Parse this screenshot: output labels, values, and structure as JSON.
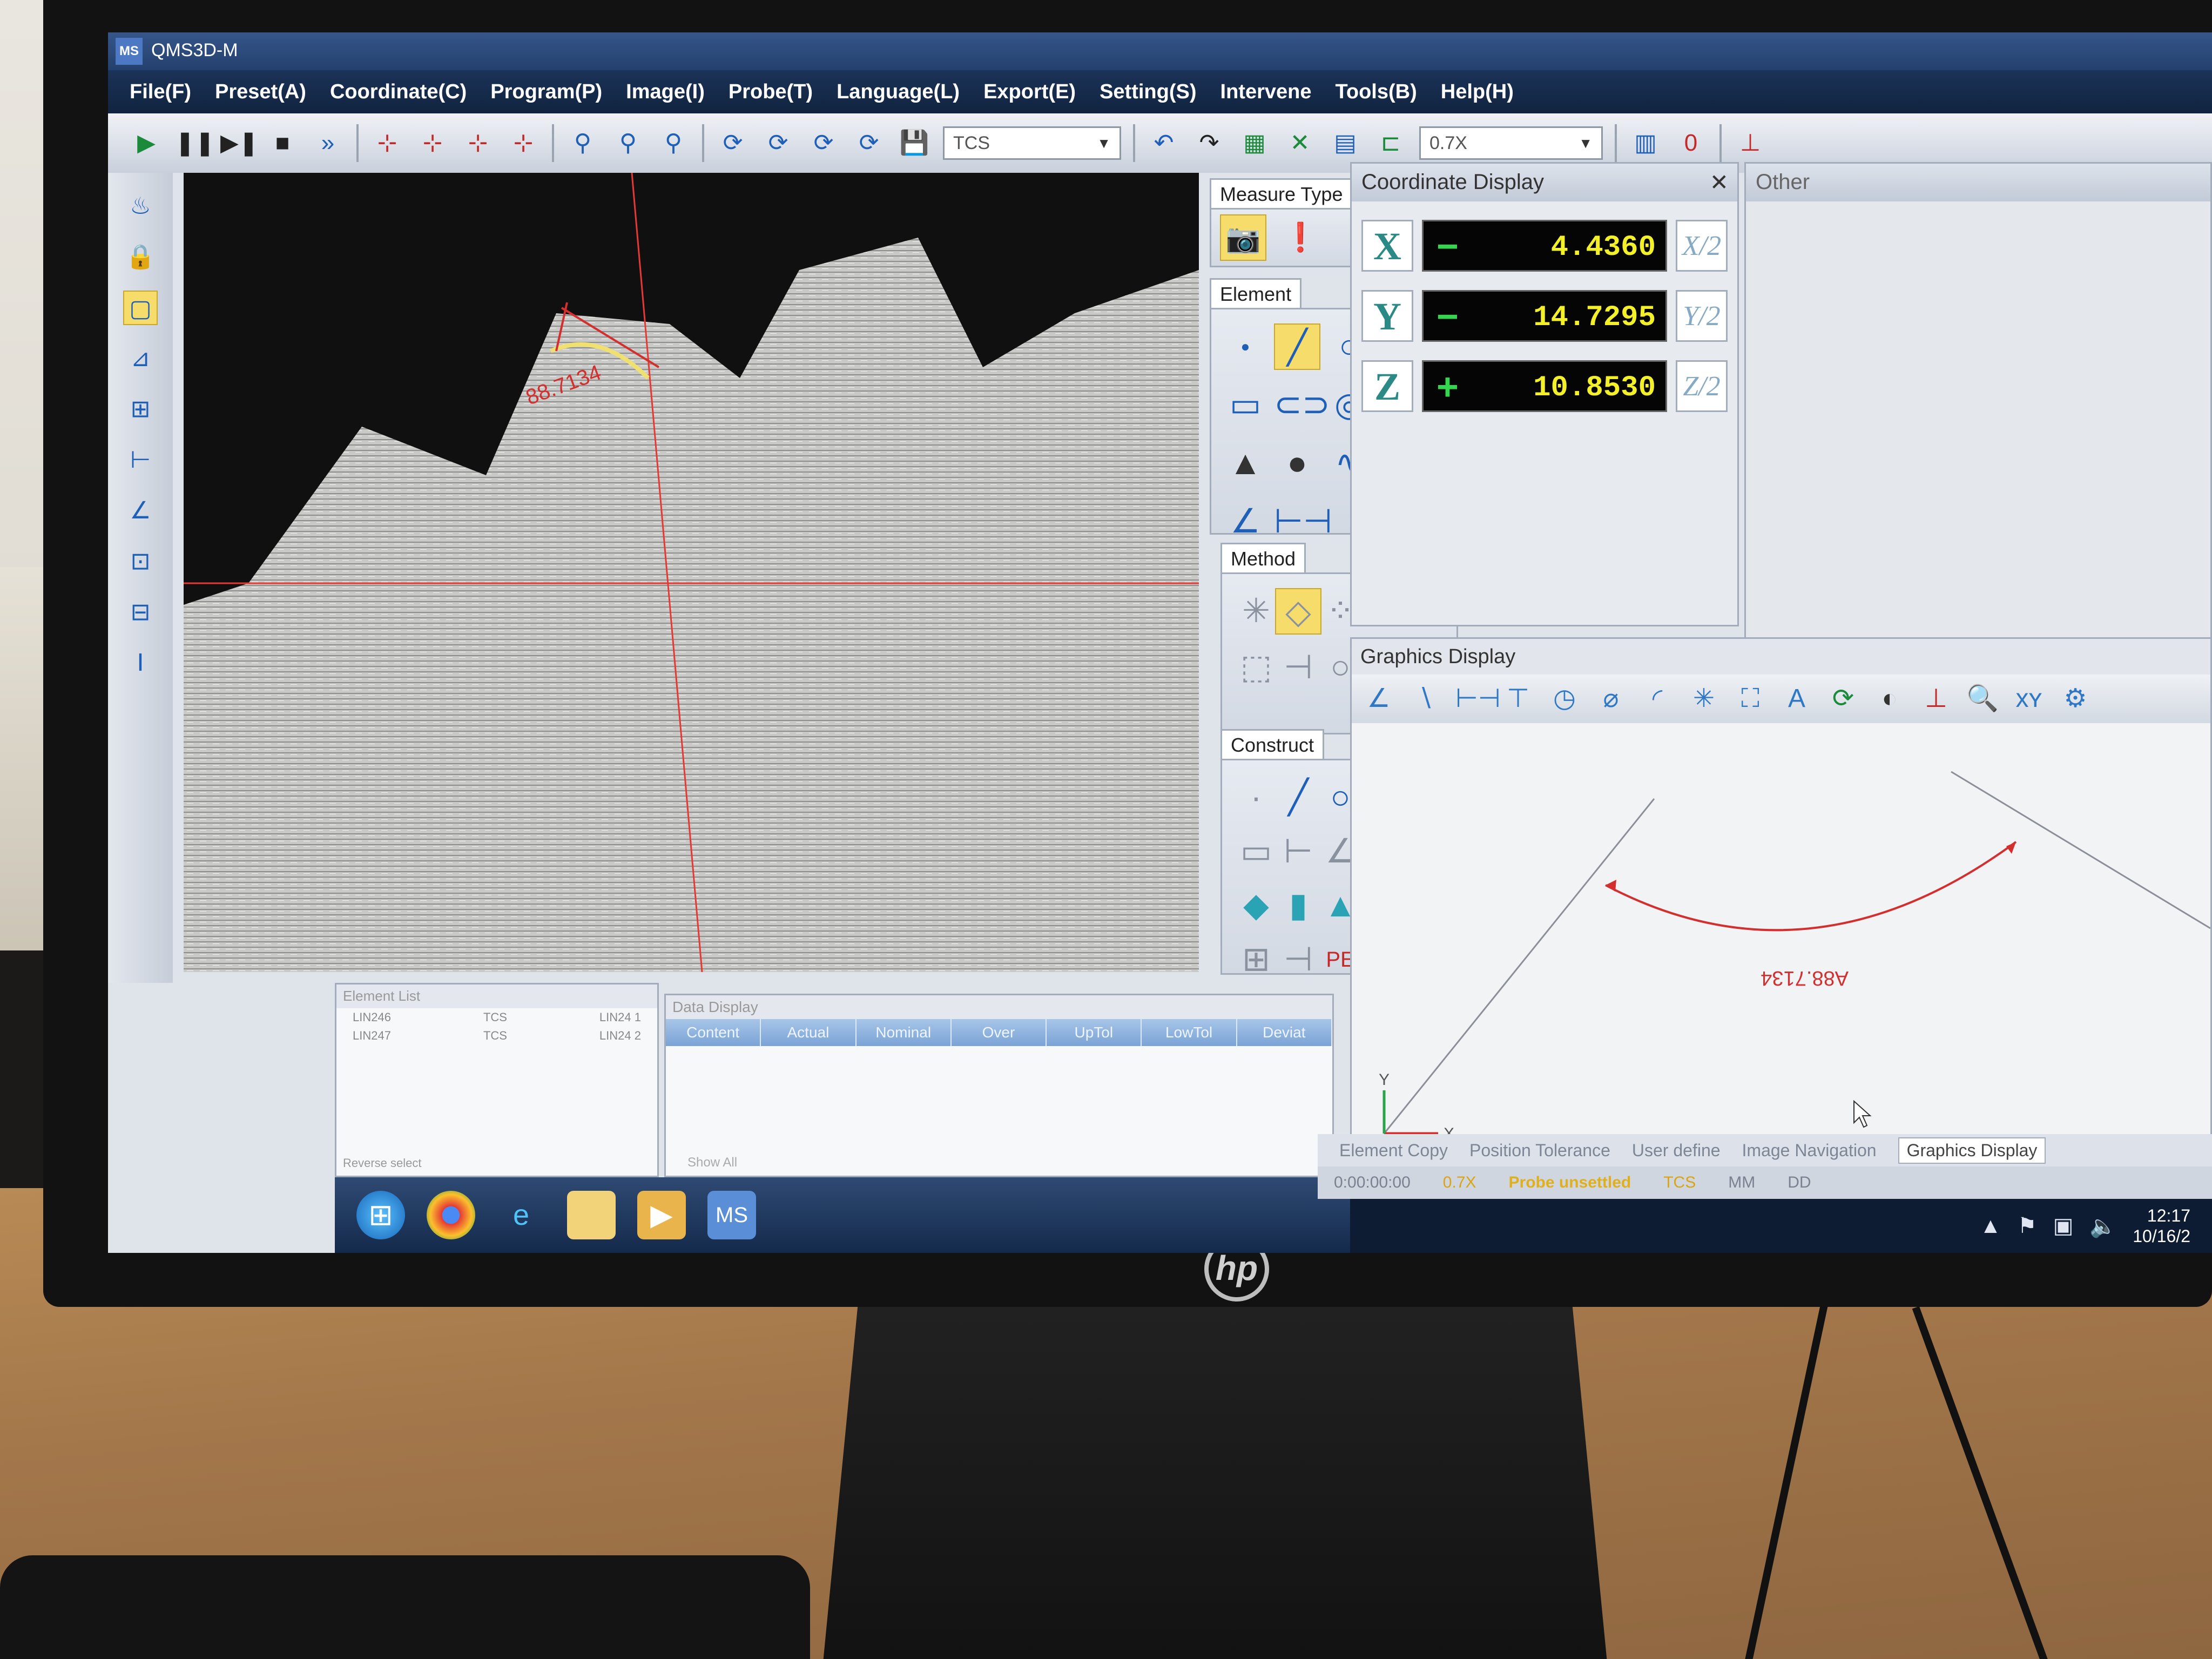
{
  "app": {
    "title": "QMS3D-M",
    "icon_label": "MS"
  },
  "menu": [
    "File(F)",
    "Preset(A)",
    "Coordinate(C)",
    "Program(P)",
    "Image(I)",
    "Probe(T)",
    "Language(L)",
    "Export(E)",
    "Setting(S)",
    "Intervene",
    "Tools(B)",
    "Help(H)"
  ],
  "toolbar": {
    "coord_system": "TCS",
    "zoom": "0.7X",
    "probe_counter": "0"
  },
  "measure_type": {
    "title": "Measure Type"
  },
  "element_panel": {
    "title": "Element"
  },
  "method_panel": {
    "title": "Method"
  },
  "construct_panel": {
    "title": "Construct",
    "pe_label": "PE"
  },
  "coordinate_display": {
    "title": "Coordinate Display",
    "x": {
      "axis": "X",
      "sign": "−",
      "value": "4.4360",
      "half": "X/2"
    },
    "y": {
      "axis": "Y",
      "sign": "−",
      "value": "14.7295",
      "half": "Y/2"
    },
    "z": {
      "axis": "Z",
      "sign": "+",
      "value": "10.8530",
      "half": "Z/2"
    }
  },
  "other_panel": {
    "title": "Other"
  },
  "graphics_display": {
    "title": "Graphics Display",
    "annotation": "A88.7134",
    "axis_x": "X",
    "axis_y": "Y"
  },
  "camera": {
    "annotation": "88.7134"
  },
  "element_list": {
    "title": "Element List",
    "rows": [
      {
        "name": "LIN246",
        "cs": "TCS",
        "ref": "LIN24 1"
      },
      {
        "name": "LIN247",
        "cs": "TCS",
        "ref": "LIN24 2"
      }
    ],
    "footer": "Reverse select"
  },
  "data_display": {
    "title": "Data Display",
    "columns": [
      "Content",
      "Actual",
      "Nominal",
      "Over",
      "UpTol",
      "LowTol",
      "Deviat"
    ],
    "footer": "Show All"
  },
  "bottom_tabs": [
    "Element Copy",
    "Position Tolerance",
    "User define",
    "Image Navigation",
    "Graphics Display"
  ],
  "status": {
    "time": "0:00:00:00",
    "zoom": "0.7X",
    "probe": "Probe unsettled",
    "cs": "TCS",
    "unit": "MM",
    "angle": "DD"
  },
  "clock": {
    "time": "12:17",
    "date": "10/16/2"
  },
  "colors": {
    "lcd_value": "#f3f02a",
    "lcd_sign": "#35d64f",
    "selected_tool": "#f6dc6b",
    "annotation_red": "#d32f2f"
  }
}
